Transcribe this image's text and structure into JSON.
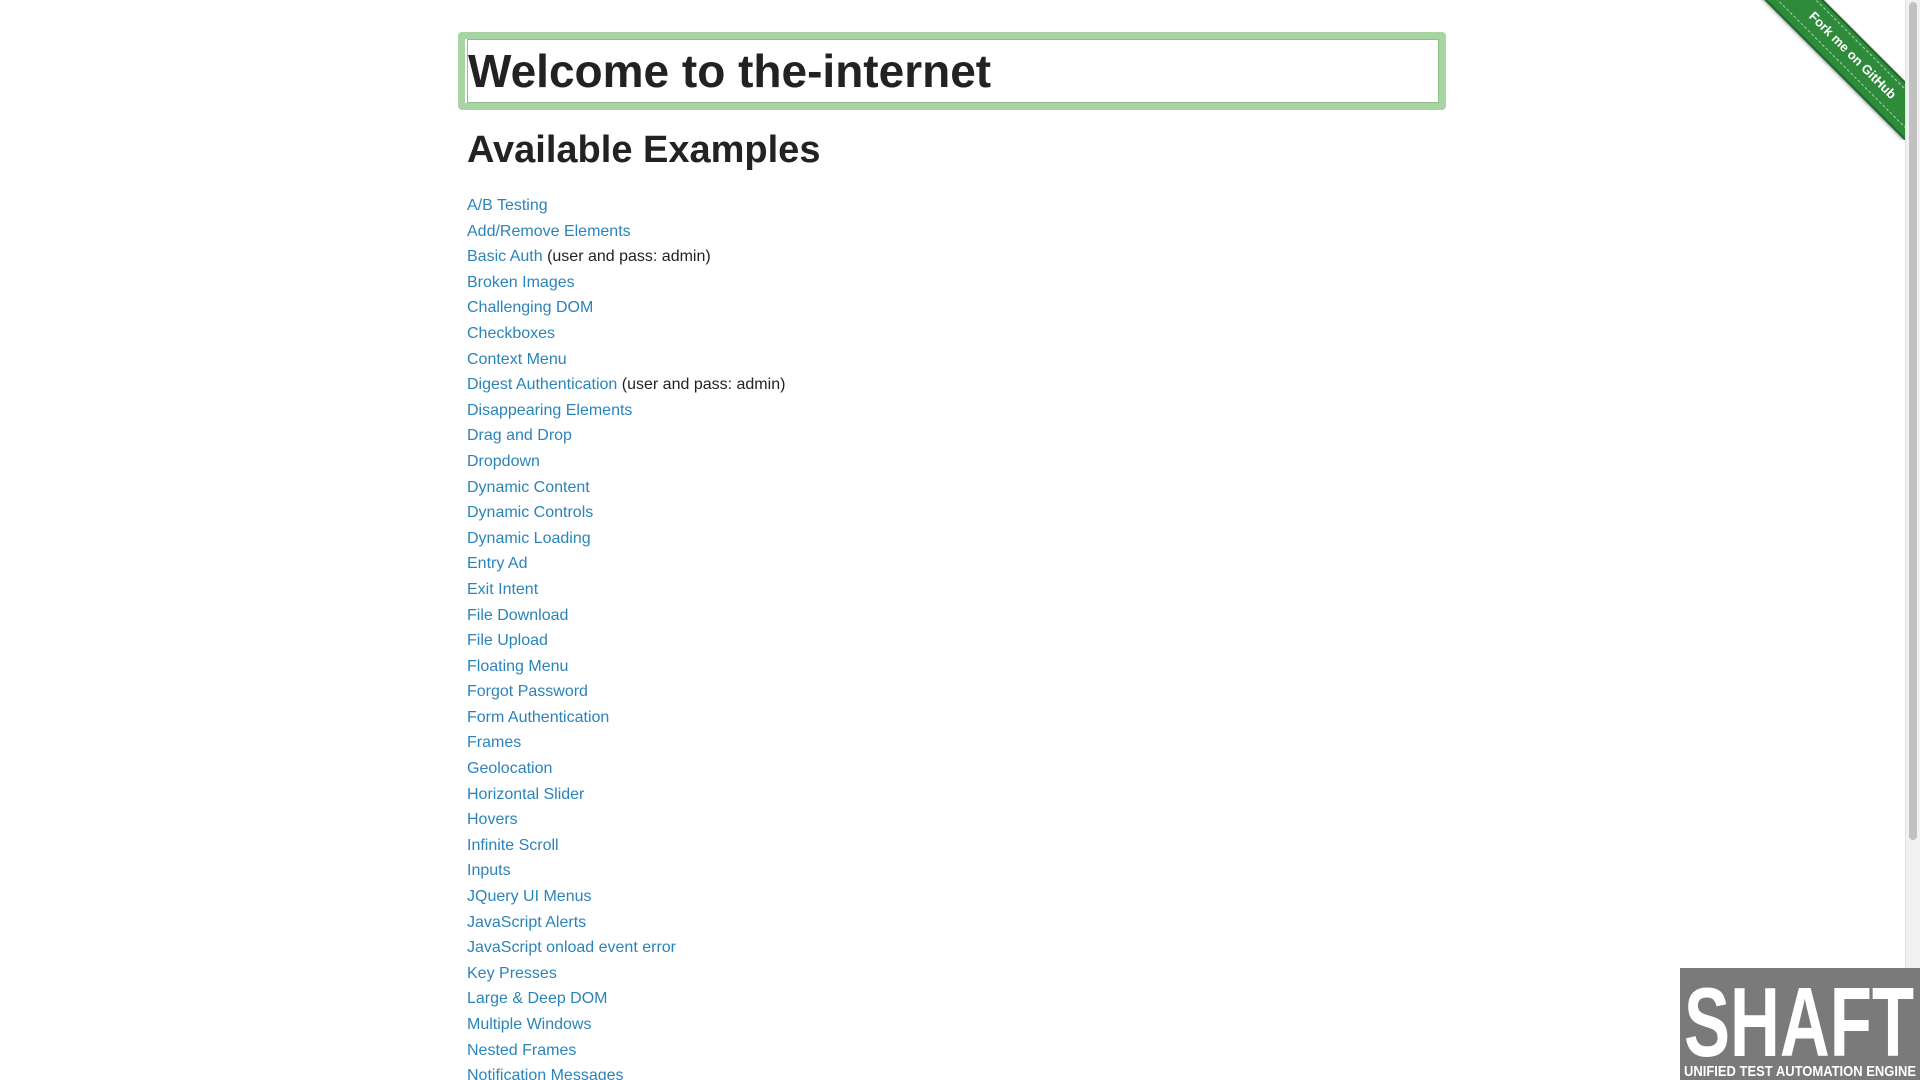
{
  "header": {
    "title": "Welcome to the-internet"
  },
  "main": {
    "heading": "Available Examples",
    "examples": [
      {
        "label": "A/B Testing",
        "note": ""
      },
      {
        "label": "Add/Remove Elements",
        "note": ""
      },
      {
        "label": "Basic Auth",
        "note": "(user and pass: admin)"
      },
      {
        "label": "Broken Images",
        "note": ""
      },
      {
        "label": "Challenging DOM",
        "note": ""
      },
      {
        "label": "Checkboxes",
        "note": ""
      },
      {
        "label": "Context Menu",
        "note": ""
      },
      {
        "label": "Digest Authentication",
        "note": "(user and pass: admin)"
      },
      {
        "label": "Disappearing Elements",
        "note": ""
      },
      {
        "label": "Drag and Drop",
        "note": ""
      },
      {
        "label": "Dropdown",
        "note": ""
      },
      {
        "label": "Dynamic Content",
        "note": ""
      },
      {
        "label": "Dynamic Controls",
        "note": ""
      },
      {
        "label": "Dynamic Loading",
        "note": ""
      },
      {
        "label": "Entry Ad",
        "note": ""
      },
      {
        "label": "Exit Intent",
        "note": ""
      },
      {
        "label": "File Download",
        "note": ""
      },
      {
        "label": "File Upload",
        "note": ""
      },
      {
        "label": "Floating Menu",
        "note": ""
      },
      {
        "label": "Forgot Password",
        "note": ""
      },
      {
        "label": "Form Authentication",
        "note": ""
      },
      {
        "label": "Frames",
        "note": ""
      },
      {
        "label": "Geolocation",
        "note": ""
      },
      {
        "label": "Horizontal Slider",
        "note": ""
      },
      {
        "label": "Hovers",
        "note": ""
      },
      {
        "label": "Infinite Scroll",
        "note": ""
      },
      {
        "label": "Inputs",
        "note": ""
      },
      {
        "label": "JQuery UI Menus",
        "note": ""
      },
      {
        "label": "JavaScript Alerts",
        "note": ""
      },
      {
        "label": "JavaScript onload event error",
        "note": ""
      },
      {
        "label": "Key Presses",
        "note": ""
      },
      {
        "label": "Large & Deep DOM",
        "note": ""
      },
      {
        "label": "Multiple Windows",
        "note": ""
      },
      {
        "label": "Nested Frames",
        "note": ""
      },
      {
        "label": "Notification Messages",
        "note": ""
      }
    ]
  },
  "fork_ribbon": {
    "label": "Fork me on GitHub"
  },
  "shaft_logo": {
    "wordmark": "SHAFT",
    "tagline": "UNIFIED TEST AUTOMATION ENGINE"
  },
  "colors": {
    "link": "#2a84ba",
    "header_border": "#a8d3a2",
    "ribbon": "#2e8b3a",
    "text": "#222222"
  }
}
